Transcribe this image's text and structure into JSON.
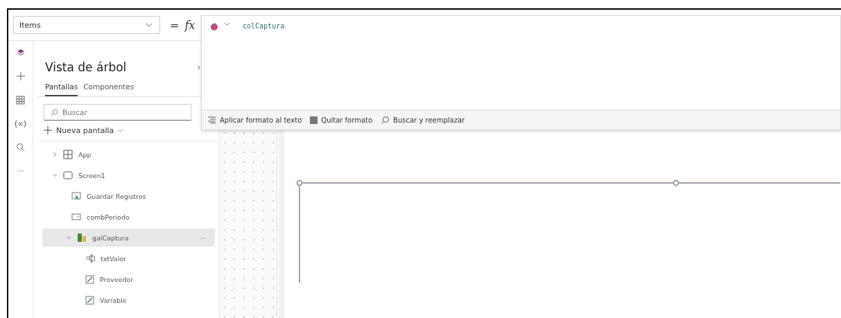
{
  "property_selector": {
    "value": "Items"
  },
  "formula_bar": {
    "equals": "=",
    "fx": "fx",
    "formula": "colCaptura"
  },
  "formula_toolbar": [
    {
      "kind": "format",
      "label": "Aplicar formato al texto"
    },
    {
      "kind": "clear",
      "label": "Quitar formato"
    },
    {
      "kind": "find",
      "label": "Buscar y reemplazar"
    }
  ],
  "rail": [
    {
      "kind": "tree",
      "selected": true
    },
    {
      "kind": "insert",
      "selected": false
    },
    {
      "kind": "data",
      "selected": false
    },
    {
      "kind": "variables",
      "label": "{x}",
      "selected": false
    },
    {
      "kind": "search",
      "selected": false
    },
    {
      "kind": "more",
      "label": "···",
      "selected": false
    }
  ],
  "tree_panel": {
    "title": "Vista de árbol",
    "close": "›",
    "tabs": [
      {
        "label": "Pantallas",
        "selected": true
      },
      {
        "label": "Componentes",
        "selected": false
      }
    ],
    "search": {
      "placeholder": "Buscar"
    },
    "new_screen": "Nueva pantalla",
    "items": [
      {
        "kind": "app",
        "label": "App",
        "expanded": false,
        "selected": false
      },
      {
        "kind": "screen",
        "label": "Screen1",
        "expanded": true,
        "selected": false,
        "children": [
          {
            "kind": "button",
            "label": "Guardar Registros",
            "selected": false
          },
          {
            "kind": "dropdown",
            "label": "combPeriodo",
            "selected": false
          },
          {
            "kind": "gallery",
            "label": "galCaptura",
            "expanded": true,
            "selected": true,
            "more": "···",
            "children": [
              {
                "kind": "textinput",
                "label": "txtValor",
                "selected": false
              },
              {
                "kind": "edit",
                "label": "Proveedor",
                "selected": false
              },
              {
                "kind": "edit",
                "label": "Variable",
                "selected": false
              }
            ]
          }
        ]
      }
    ]
  }
}
